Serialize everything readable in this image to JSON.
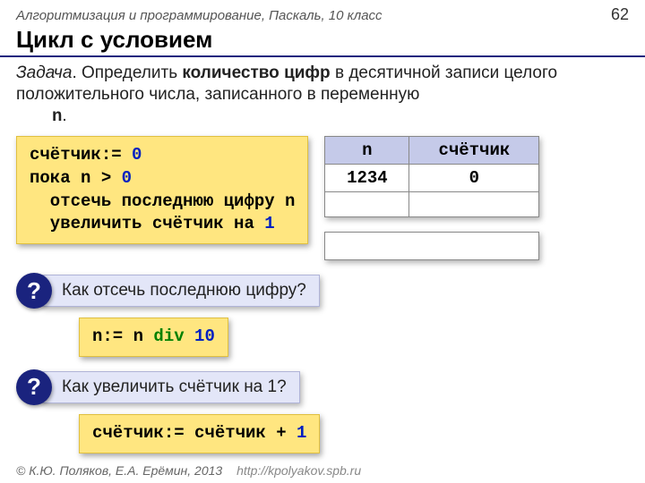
{
  "header": {
    "course": "Алгоритмизация и программирование, Паскаль, 10 класс",
    "page": "62"
  },
  "title": "Цикл с условием",
  "task": {
    "label": "Задача",
    "before_bold": ". Определить ",
    "bold": "количество цифр",
    "after_bold": " в десятичной записи целого положительного числа, записанного в переменную ",
    "var": "n",
    "end": "."
  },
  "code_main": {
    "l1a": "счётчик:= ",
    "l1b": "0",
    "l2a": "пока n > ",
    "l2b": "0",
    "l3": "  отсечь последнюю цифру n",
    "l4a": "  увеличить счётчик на ",
    "l4b": "1"
  },
  "trace": {
    "h1": "n",
    "h2": "счётчик",
    "r1c1": "1234",
    "r1c2": "0",
    "r2c1": "",
    "r2c2": ""
  },
  "q1": {
    "badge": "?",
    "text": "Как отсечь последнюю цифру?"
  },
  "code_div": {
    "a": "n:= n ",
    "kw": "div",
    "b": " 10"
  },
  "q2": {
    "badge": "?",
    "text": "Как увеличить счётчик на 1?"
  },
  "code_inc": {
    "a": "счётчик:= счётчик + ",
    "b": "1"
  },
  "footer": {
    "copyright": "© К.Ю. Поляков, Е.А. Ерёмин, 2013",
    "url": "http://kpolyakov.spb.ru"
  }
}
